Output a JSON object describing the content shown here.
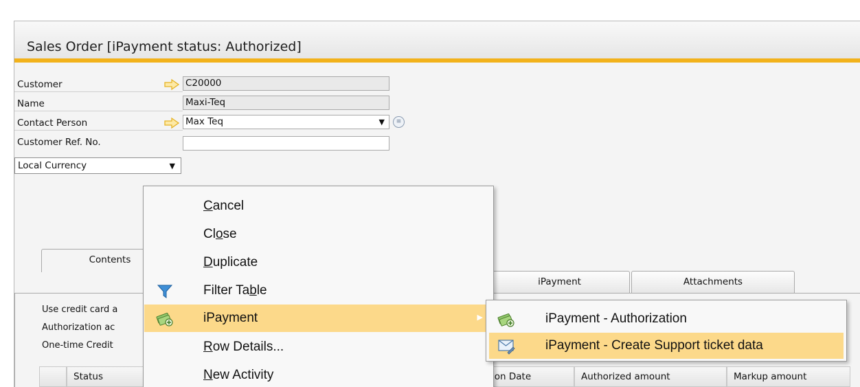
{
  "window": {
    "title": "Sales Order [iPayment status: Authorized]"
  },
  "header_fields": {
    "customer": {
      "label": "Customer",
      "value": "C20000"
    },
    "name": {
      "label": "Name",
      "value": "Maxi-Teq"
    },
    "contact_person": {
      "label": "Contact Person",
      "value": "Max Teq"
    },
    "customer_ref": {
      "label": "Customer Ref. No.",
      "value": ""
    },
    "currency_select": "Local Currency"
  },
  "tabs": [
    {
      "label": "Contents"
    },
    {
      "label": "iPayment"
    },
    {
      "label": "Attachments"
    }
  ],
  "ipayment_tab": {
    "rows": [
      "Use credit card a",
      "Authorization ac",
      "One-time Credit"
    ],
    "grid_columns": [
      "Status",
      "ion Date",
      "Authorized amount",
      "Markup amount"
    ]
  },
  "context_menu": {
    "items": [
      {
        "pre": "",
        "ul": "C",
        "post": "ancel",
        "icon": ""
      },
      {
        "pre": "Cl",
        "ul": "o",
        "post": "se",
        "icon": ""
      },
      {
        "pre": "",
        "ul": "D",
        "post": "uplicate",
        "icon": ""
      },
      {
        "pre": "Filter Ta",
        "ul": "b",
        "post": "le",
        "icon": "filter-icon"
      },
      {
        "pre": "iPayment",
        "ul": "",
        "post": "",
        "icon": "ipayment-icon"
      },
      {
        "pre": "",
        "ul": "R",
        "post": "ow Details...",
        "icon": ""
      },
      {
        "pre": "",
        "ul": "N",
        "post": "ew Activity",
        "icon": ""
      }
    ]
  },
  "submenu": {
    "items": [
      {
        "label": "iPayment - Authorization",
        "icon": "ipayment-icon"
      },
      {
        "label": "iPayment - Create Support ticket data",
        "icon": "envelope-icon"
      }
    ]
  },
  "colors": {
    "accent": "#f2b21b",
    "highlight": "#fcd98a",
    "arrow": "#f5c61a"
  }
}
